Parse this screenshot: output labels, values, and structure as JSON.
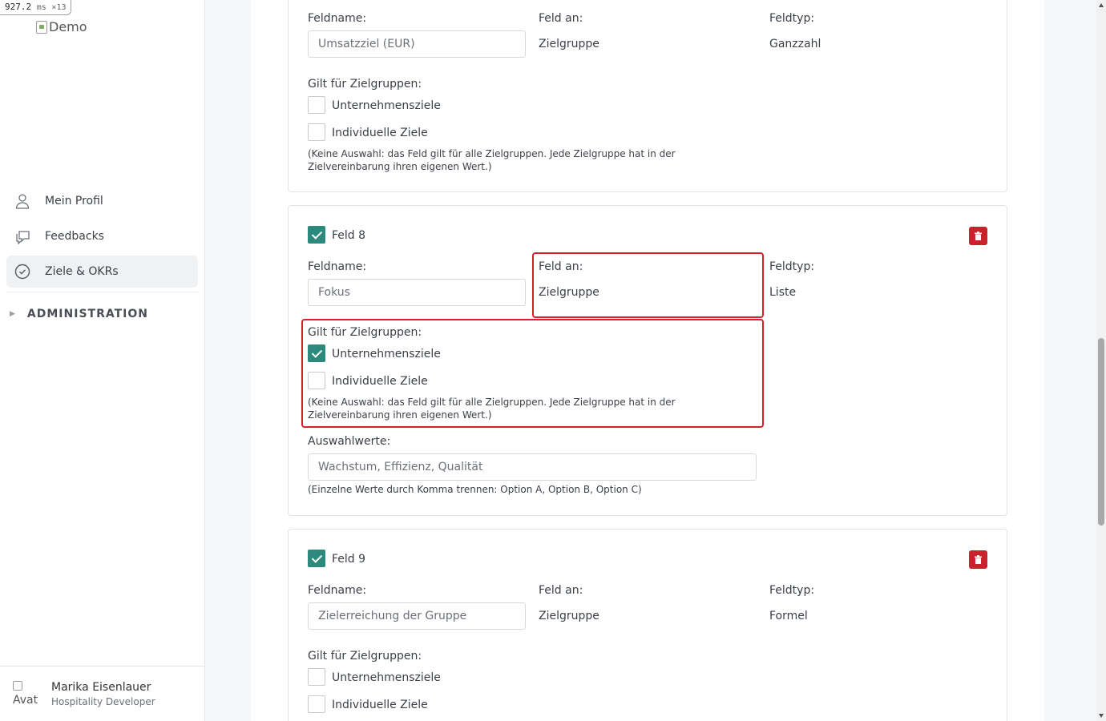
{
  "perf": {
    "value": "927.2",
    "unit": "ms",
    "count": "×13"
  },
  "sidebar": {
    "logo_alt": "Demo",
    "nav": [
      {
        "label": "Mein Profil",
        "icon": "user-icon"
      },
      {
        "label": "Feedbacks",
        "icon": "chat-icon"
      },
      {
        "label": "Ziele & OKRs",
        "icon": "check-circle-icon",
        "active": true
      }
    ],
    "section": "ADMINISTRATION",
    "user": {
      "avatar_alt": "Avat",
      "name": "Marika Eisenlauer",
      "role": "Hospitality Developer"
    }
  },
  "labels": {
    "field_name": "Feldname:",
    "field_on": "Feld an:",
    "field_type": "Feldtyp:",
    "applies_to": "Gilt für Zielgruppen:",
    "company_goals": "Unternehmensziele",
    "individual_goals": "Individuelle Ziele",
    "hint": "(Keine Auswahl: das Feld gilt für alle Zielgruppen. Jede Zielgruppe hat in der Zielvereinbarung ihren eigenen Wert.)",
    "options": "Auswahlwerte:",
    "options_hint": "(Einzelne Werte durch Komma trennen: Option A, Option B, Option C)"
  },
  "fields": [
    {
      "name_value": "Umsatzziel (EUR)",
      "on": "Zielgruppe",
      "type": "Ganzzahl",
      "company": false,
      "individual": false
    },
    {
      "title": "Feld 8",
      "enabled": true,
      "name_value": "Fokus",
      "on": "Zielgruppe",
      "type": "Liste",
      "company": true,
      "individual": false,
      "options_value": "Wachstum, Effizienz, Qualität"
    },
    {
      "title": "Feld 9",
      "enabled": true,
      "name_value": "Zielerreichung der Gruppe",
      "on": "Zielgruppe",
      "type": "Formel",
      "company": false,
      "individual": false
    }
  ],
  "colors": {
    "accent": "#2b8a7b",
    "danger": "#c8232c",
    "highlight": "#d3222a"
  }
}
